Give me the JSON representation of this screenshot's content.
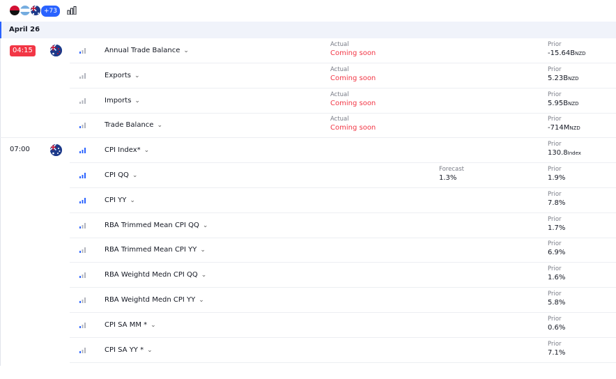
{
  "header": {
    "more_countries": "+73",
    "flags": [
      "angola-flag",
      "argentina-flag",
      "australia-flag"
    ]
  },
  "date": "April 26",
  "rows": [
    {
      "time": "04:15",
      "time_highlight": true,
      "country": "new-zealand",
      "event": "Annual Trade Balance",
      "importance": 1,
      "actual_label": "Actual",
      "actual": "Coming soon",
      "forecast_label": "",
      "forecast": "",
      "prior_label": "Prior",
      "prior": "-15.64B",
      "prior_unit": "NZD"
    },
    {
      "time": "",
      "country": "",
      "event": "Exports",
      "importance": 0,
      "actual_label": "Actual",
      "actual": "Coming soon",
      "forecast_label": "",
      "forecast": "",
      "prior_label": "Prior",
      "prior": "5.23B",
      "prior_unit": "NZD"
    },
    {
      "time": "",
      "country": "",
      "event": "Imports",
      "importance": 0,
      "actual_label": "Actual",
      "actual": "Coming soon",
      "forecast_label": "",
      "forecast": "",
      "prior_label": "Prior",
      "prior": "5.95B",
      "prior_unit": "NZD"
    },
    {
      "time": "",
      "country": "",
      "event": "Trade Balance",
      "importance": 1,
      "actual_label": "Actual",
      "actual": "Coming soon",
      "forecast_label": "",
      "forecast": "",
      "prior_label": "Prior",
      "prior": "-714M",
      "prior_unit": "NZD"
    },
    {
      "time": "07:00",
      "time_highlight": false,
      "country": "australia",
      "event": "CPI Index*",
      "importance": 3,
      "actual_label": "",
      "actual": "",
      "forecast_label": "",
      "forecast": "",
      "prior_label": "Prior",
      "prior": "130.8",
      "prior_unit": "Index"
    },
    {
      "time": "",
      "country": "",
      "event": "CPI QQ",
      "importance": 3,
      "actual_label": "",
      "actual": "",
      "forecast_label": "Forecast",
      "forecast": "1.3%",
      "prior_label": "Prior",
      "prior": "1.9%",
      "prior_unit": ""
    },
    {
      "time": "",
      "country": "",
      "event": "CPI YY",
      "importance": 3,
      "actual_label": "",
      "actual": "",
      "forecast_label": "",
      "forecast": "",
      "prior_label": "Prior",
      "prior": "7.8%",
      "prior_unit": ""
    },
    {
      "time": "",
      "country": "",
      "event": "RBA Trimmed Mean CPI QQ",
      "importance": 1,
      "actual_label": "",
      "actual": "",
      "forecast_label": "",
      "forecast": "",
      "prior_label": "Prior",
      "prior": "1.7%",
      "prior_unit": ""
    },
    {
      "time": "",
      "country": "",
      "event": "RBA Trimmed Mean CPI YY",
      "importance": 1,
      "actual_label": "",
      "actual": "",
      "forecast_label": "",
      "forecast": "",
      "prior_label": "Prior",
      "prior": "6.9%",
      "prior_unit": ""
    },
    {
      "time": "",
      "country": "",
      "event": "RBA Weightd Medn CPI QQ",
      "importance": 1,
      "actual_label": "",
      "actual": "",
      "forecast_label": "",
      "forecast": "",
      "prior_label": "Prior",
      "prior": "1.6%",
      "prior_unit": ""
    },
    {
      "time": "",
      "country": "",
      "event": "RBA Weightd Medn CPI YY",
      "importance": 1,
      "actual_label": "",
      "actual": "",
      "forecast_label": "",
      "forecast": "",
      "prior_label": "Prior",
      "prior": "5.8%",
      "prior_unit": ""
    },
    {
      "time": "",
      "country": "",
      "event": "CPI SA MM *",
      "importance": 1,
      "actual_label": "",
      "actual": "",
      "forecast_label": "",
      "forecast": "",
      "prior_label": "Prior",
      "prior": "0.6%",
      "prior_unit": ""
    },
    {
      "time": "",
      "country": "",
      "event": "CPI SA YY *",
      "importance": 1,
      "actual_label": "",
      "actual": "",
      "forecast_label": "",
      "forecast": "",
      "prior_label": "Prior",
      "prior": "7.1%",
      "prior_unit": ""
    }
  ],
  "colors": {
    "accent": "#2962ff",
    "negative": "#f23645",
    "muted": "#787b86",
    "importance_on": "#2962ff",
    "importance_off": "#b2b5be"
  }
}
